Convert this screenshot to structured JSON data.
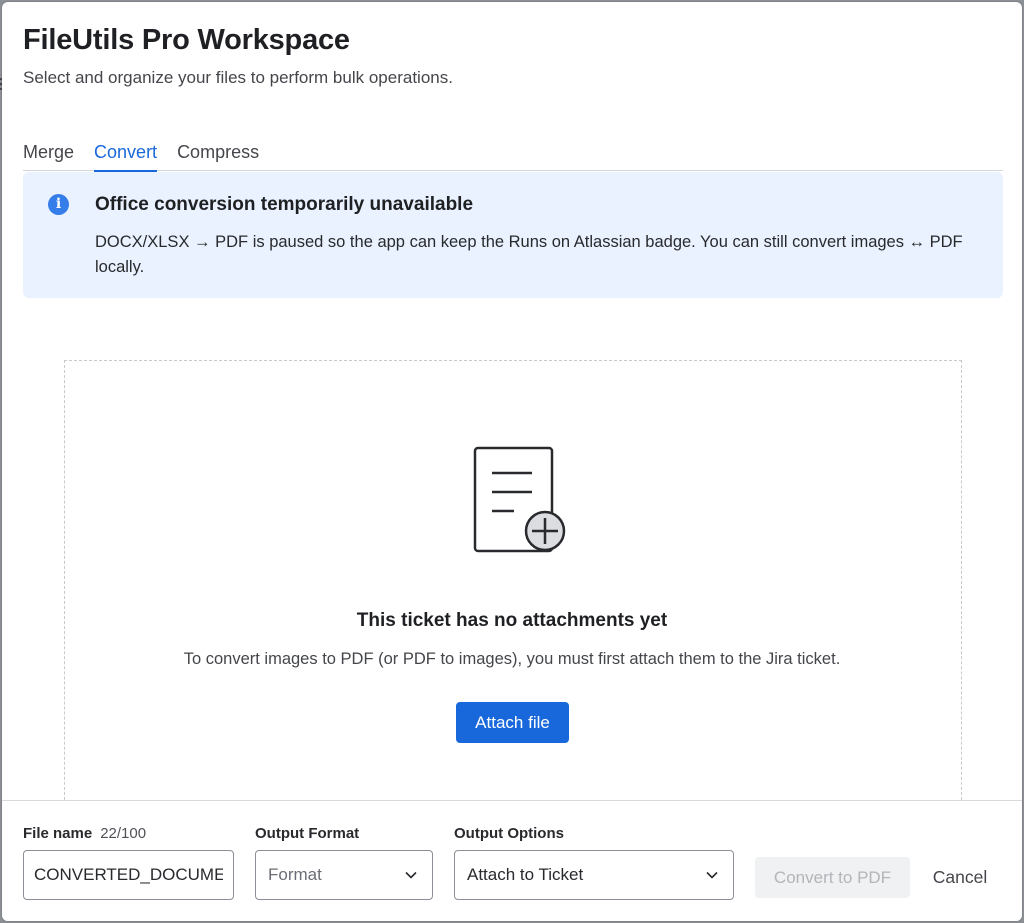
{
  "backdrop": {
    "glyph": "s"
  },
  "modal": {
    "title": "FileUtils Pro Workspace",
    "subtitle": "Select and organize your files to perform bulk operations."
  },
  "tabs": [
    {
      "label": "Merge",
      "active": false
    },
    {
      "label": "Convert",
      "active": true
    },
    {
      "label": "Compress",
      "active": false
    }
  ],
  "banner": {
    "icon": "info-icon",
    "title": "Office conversion temporarily unavailable",
    "body": "DOCX/XLSX → PDF is paused so the app can keep the Runs on Atlassian badge. You can still convert images ↔ PDF locally."
  },
  "empty_state": {
    "icon": "document-add-icon",
    "title": "This ticket has no attachments yet",
    "description": "To convert images to PDF (or PDF to images), you must first attach them to the Jira ticket.",
    "attach_label": "Attach file"
  },
  "footer": {
    "file_name": {
      "label": "File name",
      "counter": "22/100",
      "value": "CONVERTED_DOCUMENT"
    },
    "output_format": {
      "label": "Output Format",
      "placeholder": "Format"
    },
    "output_options": {
      "label": "Output Options",
      "value": "Attach to Ticket"
    },
    "convert_label": "Convert to PDF",
    "cancel_label": "Cancel"
  },
  "colors": {
    "accent": "#1868db",
    "banner_bg": "#e9f2fe",
    "info_icon": "#357de8"
  }
}
